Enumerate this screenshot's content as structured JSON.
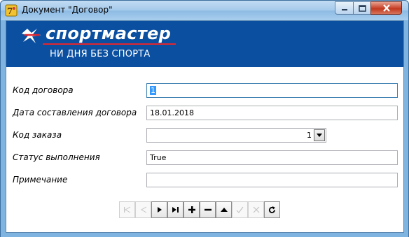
{
  "window": {
    "title": "Документ \"Договор\"",
    "icons": {
      "app": "app-icon",
      "minimize": "minimize-icon",
      "maximize": "maximize-icon",
      "close": "close-icon"
    }
  },
  "banner": {
    "logo_text": "спортмастер",
    "slogan": "НИ ДНЯ БЕЗ СПОРТА",
    "logo_icon": "sportmaster-star-logo-icon",
    "colors": {
      "background": "#0a4fa0",
      "star": "#e3262e",
      "text": "#ffffff"
    }
  },
  "form": {
    "contract_code": {
      "label": "Код договора",
      "value": "1"
    },
    "date": {
      "label": "Дата составления договора",
      "value": "18.01.2018"
    },
    "order_code": {
      "label": "Код заказа",
      "value": "1"
    },
    "status": {
      "label": "Статус выполнения",
      "value": "True"
    },
    "note": {
      "label": "Примечание",
      "value": ""
    }
  },
  "navigator": {
    "buttons": [
      {
        "name": "first-record",
        "icon": "first-record-icon",
        "enabled": false
      },
      {
        "name": "prior-record",
        "icon": "prior-record-icon",
        "enabled": false
      },
      {
        "name": "next-record",
        "icon": "next-record-icon",
        "enabled": true
      },
      {
        "name": "last-record",
        "icon": "last-record-icon",
        "enabled": true
      },
      {
        "name": "insert-record",
        "icon": "plus-icon",
        "enabled": true
      },
      {
        "name": "delete-record",
        "icon": "minus-icon",
        "enabled": true
      },
      {
        "name": "edit-record",
        "icon": "edit-triangle-icon",
        "enabled": true
      },
      {
        "name": "post-record",
        "icon": "check-icon",
        "enabled": false
      },
      {
        "name": "cancel-record",
        "icon": "cancel-x-icon",
        "enabled": false
      },
      {
        "name": "refresh-record",
        "icon": "refresh-icon",
        "enabled": true
      }
    ]
  }
}
